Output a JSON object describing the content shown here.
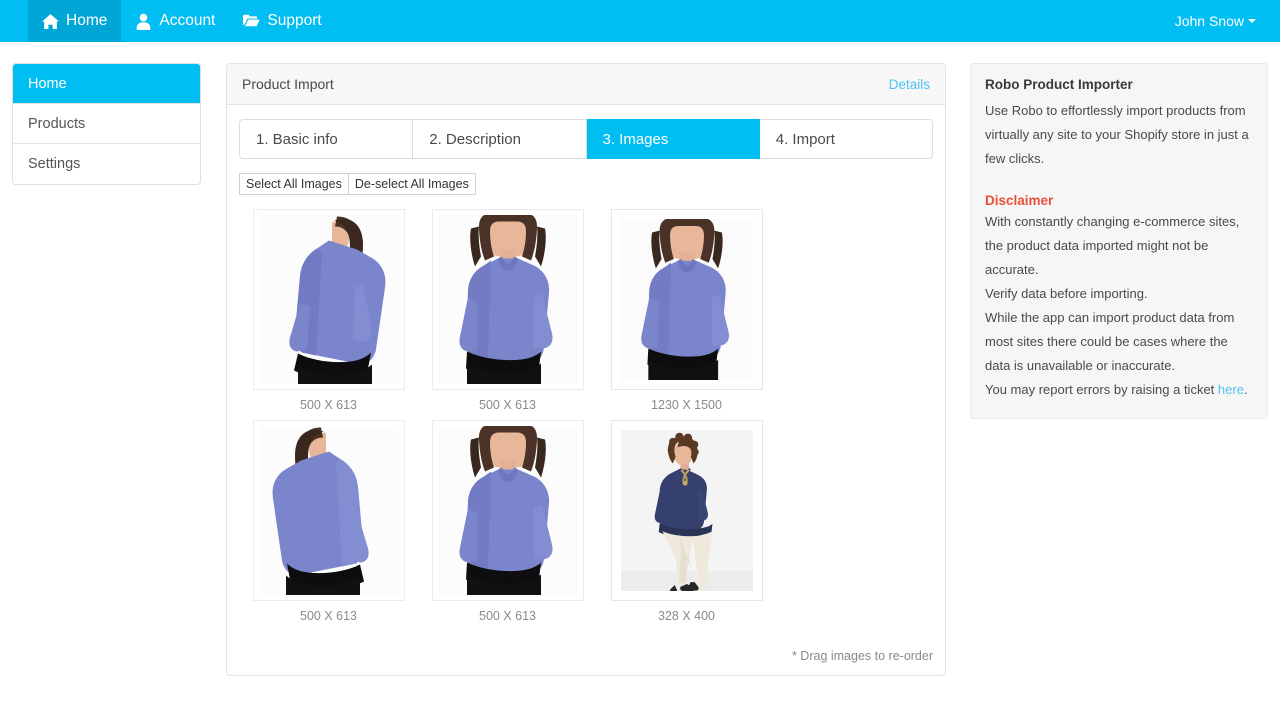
{
  "navbar": {
    "items": [
      {
        "label": "Home",
        "icon": "home-icon",
        "active": true
      },
      {
        "label": "Account",
        "icon": "user-icon",
        "active": false
      },
      {
        "label": "Support",
        "icon": "folder-icon",
        "active": false
      }
    ],
    "user": "John Snow"
  },
  "sidenav": {
    "items": [
      {
        "label": "Home",
        "active": true
      },
      {
        "label": "Products",
        "active": false
      },
      {
        "label": "Settings",
        "active": false
      }
    ]
  },
  "panel": {
    "title": "Product Import",
    "details_link": "Details",
    "tabs": [
      {
        "label": "1. Basic info",
        "active": false
      },
      {
        "label": "2. Description",
        "active": false
      },
      {
        "label": "3. Images",
        "active": true
      },
      {
        "label": "4. Import",
        "active": false
      }
    ],
    "buttons": {
      "select_all": "Select All Images",
      "deselect_all": "De-select All Images"
    },
    "images": [
      {
        "size": "500 X 613",
        "pose": "back",
        "top": "periwinkle",
        "bottom": "black",
        "wide_frame": false
      },
      {
        "size": "500 X 613",
        "pose": "front",
        "top": "periwinkle",
        "bottom": "black",
        "wide_frame": false
      },
      {
        "size": "1230 X 1500",
        "pose": "front",
        "top": "periwinkle",
        "bottom": "black",
        "wide_frame": true
      },
      {
        "size": "500 X 613",
        "pose": "back",
        "top": "periwinkle",
        "bottom": "black",
        "wide_frame": false
      },
      {
        "size": "500 X 613",
        "pose": "front",
        "top": "periwinkle",
        "bottom": "black",
        "wide_frame": false
      },
      {
        "size": "328 X 400",
        "pose": "full-body",
        "top": "navy",
        "bottom": "cream",
        "wide_frame": true
      }
    ],
    "drag_note": "* Drag images to re-order"
  },
  "aside": {
    "title": "Robo Product Importer",
    "intro": "Use Robo to effortlessly import products from virtually any site to your Shopify store in just a few clicks.",
    "disclaimer_heading": "Disclaimer",
    "disclaimer_lines": [
      "With constantly changing e-commerce sites, the product data imported might not be accurate.",
      "Verify data before importing.",
      "While the app can import product data from most sites there could be cases where the data is unavailable or inaccurate."
    ],
    "report_prefix": "You may report errors by raising a ticket ",
    "report_link": "here",
    "report_suffix": "."
  },
  "colors": {
    "brand": "#00bdf2",
    "brand_dark": "#00a7d6",
    "link": "#4ec3f0",
    "danger": "#e8503a",
    "garment_periwinkle": "#7b85cc",
    "garment_navy": "#36406e"
  }
}
